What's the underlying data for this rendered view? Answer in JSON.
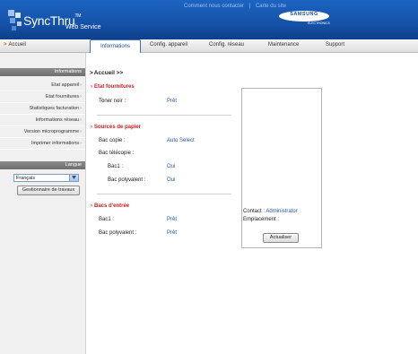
{
  "header": {
    "logo_main": "SyncThru",
    "logo_tm": "TM",
    "logo_sub": "Web Service",
    "links": [
      "Comment nous contacter",
      "|",
      "Carte du site"
    ],
    "brand": "SAMSUNG",
    "brand_sub": "ELECTRONICS"
  },
  "nav": {
    "home": "Accueil",
    "tabs": [
      "Informations",
      "Config. appareil",
      "Config. réseau",
      "Maintenance",
      "Support"
    ],
    "active_tab": "Informations"
  },
  "sidebar": {
    "title": "Informations",
    "items": [
      "Etat appareil",
      "Etat fournitures",
      "Statistiques facturation",
      "Informations réseau",
      "Version microprogramme",
      "Imprimer informations"
    ],
    "lang_title": "Langue",
    "lang_value": "Français",
    "job_button": "Gestionnaire de travaux"
  },
  "main": {
    "breadcrumb": "Accueil >>",
    "supplies": {
      "title": "Etat fournitures",
      "rows": [
        {
          "label": "Toner noir :",
          "value": "Prêt"
        }
      ]
    },
    "paper_sources": {
      "title": "Sources de papier",
      "rows": [
        {
          "label": "Bac copie :",
          "value": "Auto Select"
        },
        {
          "label": "Bac télécopie :",
          "value": ""
        },
        {
          "label": "Bac1 :",
          "value": "Oui"
        },
        {
          "label": "Bac polyvalent :",
          "value": "Oui"
        }
      ]
    },
    "input_trays": {
      "title": "Bacs d'entrée",
      "rows": [
        {
          "label": "Bac1 :",
          "value": "Prêt"
        },
        {
          "label": "Bac polyvalent :",
          "value": "Prêt"
        }
      ]
    }
  },
  "panel": {
    "contact_label": "Contact :",
    "contact_value": "Administrator",
    "location_label": "Emplacement :",
    "refresh_button": "Actualiser"
  },
  "colors": {
    "header_blue": "#1c64c2",
    "section_red": "#d11d1d",
    "value_blue": "#2a56a8"
  }
}
